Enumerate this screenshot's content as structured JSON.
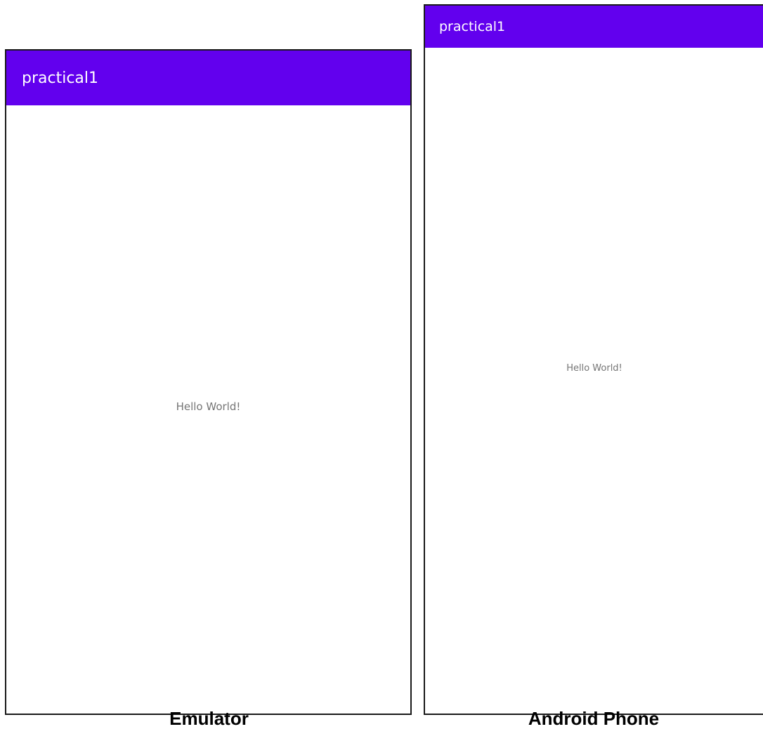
{
  "colors": {
    "app_bar": "#6200EE",
    "app_bar_text": "#FFFFFF",
    "body_text": "#757575",
    "frame_border": "#1A1A1A"
  },
  "emulator": {
    "app_title": "practical1",
    "body_text": "Hello World!",
    "caption": "Emulator"
  },
  "phone": {
    "app_title": "practical1",
    "body_text": "Hello World!",
    "caption": "Android Phone"
  }
}
